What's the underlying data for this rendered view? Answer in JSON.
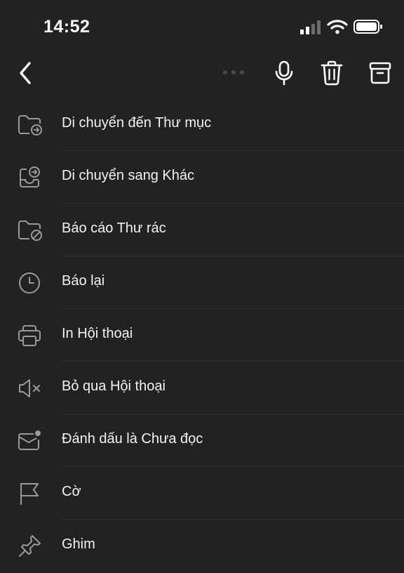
{
  "status_bar": {
    "time": "14:52"
  },
  "toolbar": {
    "back_icon": "chevron-left-icon",
    "mic_icon": "microphone-icon",
    "delete_icon": "trash-icon",
    "archive_icon": "archive-icon"
  },
  "menu": {
    "items": [
      {
        "label": "Di chuyển đến Thư mục",
        "icon": "folder-move-icon"
      },
      {
        "label": "Di chuyển sang Khác",
        "icon": "inbox-move-icon"
      },
      {
        "label": "Báo cáo Thư rác",
        "icon": "folder-block-icon"
      },
      {
        "label": "Báo lại",
        "icon": "clock-icon"
      },
      {
        "label": "In Hội thoại",
        "icon": "printer-icon"
      },
      {
        "label": "Bỏ qua Hội thoại",
        "icon": "speaker-mute-icon"
      },
      {
        "label": "Đánh dấu là Chưa đọc",
        "icon": "mail-unread-icon"
      },
      {
        "label": "Cờ",
        "icon": "flag-icon"
      },
      {
        "label": "Ghim",
        "icon": "pin-icon"
      }
    ]
  },
  "colors": {
    "background": "#222222",
    "icon": "#9a9a9a",
    "text": "#f2f2f2",
    "separator": "#2f2f2f"
  }
}
